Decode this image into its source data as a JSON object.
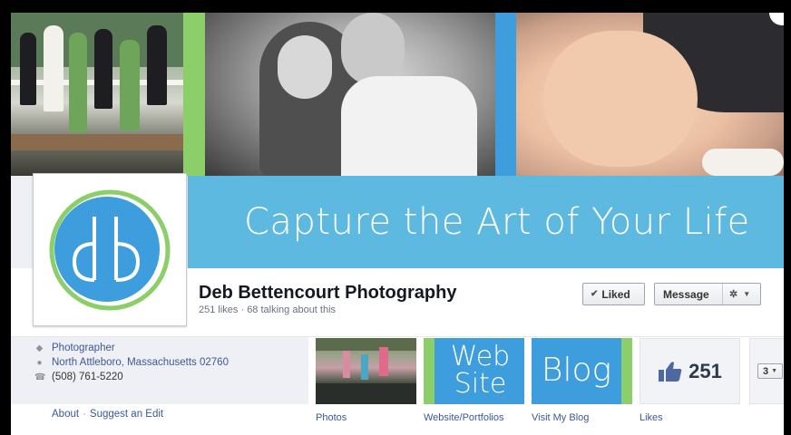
{
  "cover": {
    "tagline": "Capture the Art of Your Life"
  },
  "page": {
    "name": "Deb Bettencourt Photography",
    "stats": "251 likes · 68 talking about this"
  },
  "actions": {
    "liked_label": "Liked",
    "message_label": "Message"
  },
  "about": {
    "category": "Photographer",
    "address": "North Attleboro, Massachusetts 02760",
    "phone": "(508) 761-5220",
    "about_link": "About",
    "separator": "·",
    "suggest_link": "Suggest an Edit"
  },
  "apps": [
    {
      "label": "Photos"
    },
    {
      "label": "Website/Portfolios",
      "tile_line1": "Web",
      "tile_line2": "Site"
    },
    {
      "label": "Visit My Blog",
      "tile_text": "Blog"
    },
    {
      "label": "Likes",
      "count": "251"
    }
  ],
  "more": {
    "count": "3"
  },
  "colors": {
    "cover_blue": "#5db9e0",
    "accent_blue": "#3d9ddd",
    "accent_green": "#8ccf6a",
    "link": "#3b5998"
  },
  "icons": [
    "tag-icon",
    "map-pin-icon",
    "phone-icon",
    "check-icon",
    "gear-icon",
    "thumbs-up-icon",
    "chevron-down-icon"
  ]
}
